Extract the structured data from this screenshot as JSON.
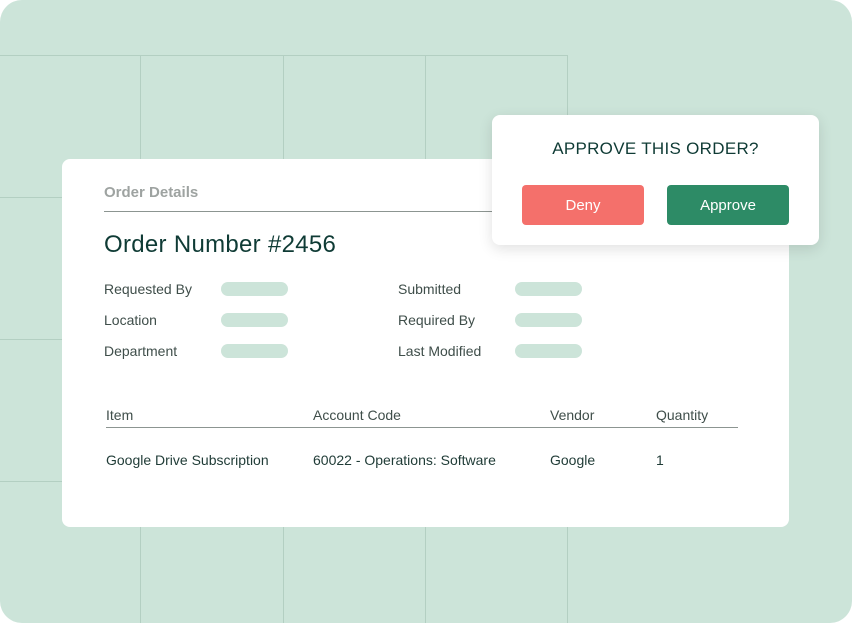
{
  "order_card": {
    "header": "Order Details",
    "title": "Order Number #2456",
    "fields_left": [
      {
        "label": "Requested By"
      },
      {
        "label": "Location"
      },
      {
        "label": "Department"
      }
    ],
    "fields_right": [
      {
        "label": "Submitted"
      },
      {
        "label": "Required By"
      },
      {
        "label": "Last Modified"
      }
    ],
    "table": {
      "columns": [
        "Item",
        "Account Code",
        "Vendor",
        "Quantity"
      ],
      "rows": [
        [
          "Google Drive Subscription",
          "60022 - Operations: Software",
          "Google",
          "1"
        ]
      ]
    }
  },
  "approval_popup": {
    "title": "APPROVE THIS ORDER?",
    "deny_label": "Deny",
    "approve_label": "Approve"
  },
  "colors": {
    "background": "#cce4d9",
    "deny": "#f4706b",
    "approve": "#2d8b66",
    "title_text": "#0f3b35"
  }
}
